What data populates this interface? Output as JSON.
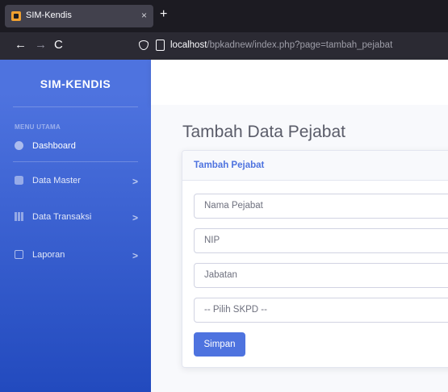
{
  "browser": {
    "tab_title": "SIM-Kendis",
    "tab_close": "×",
    "new_tab": "+",
    "back": "←",
    "forward": "→",
    "reload": "C",
    "url_host": "localhost",
    "url_path": "/bpkadnew/index.php?page=tambah_pejabat"
  },
  "sidebar": {
    "brand": "SIM-KENDIS",
    "heading": "MENU UTAMA",
    "items": [
      {
        "label": "Dashboard",
        "icon": "dashboard-icon",
        "has_chevron": false
      },
      {
        "label": "Data Master",
        "icon": "database-icon",
        "has_chevron": true
      },
      {
        "label": "Data Transaksi",
        "icon": "table-icon",
        "has_chevron": true
      },
      {
        "label": "Laporan",
        "icon": "print-icon",
        "has_chevron": true
      }
    ],
    "chevron": ">"
  },
  "main": {
    "page_title": "Tambah Data Pejabat",
    "card_title": "Tambah Pejabat",
    "form": {
      "nama_placeholder": "Nama Pejabat",
      "nip_placeholder": "NIP",
      "jabatan_placeholder": "Jabatan",
      "skpd_selected": "-- Pilih SKPD --",
      "save_label": "Simpan"
    }
  },
  "colors": {
    "primary": "#4e73df",
    "sidebar_bottom": "#224abe",
    "text_muted": "#5a5c69"
  }
}
